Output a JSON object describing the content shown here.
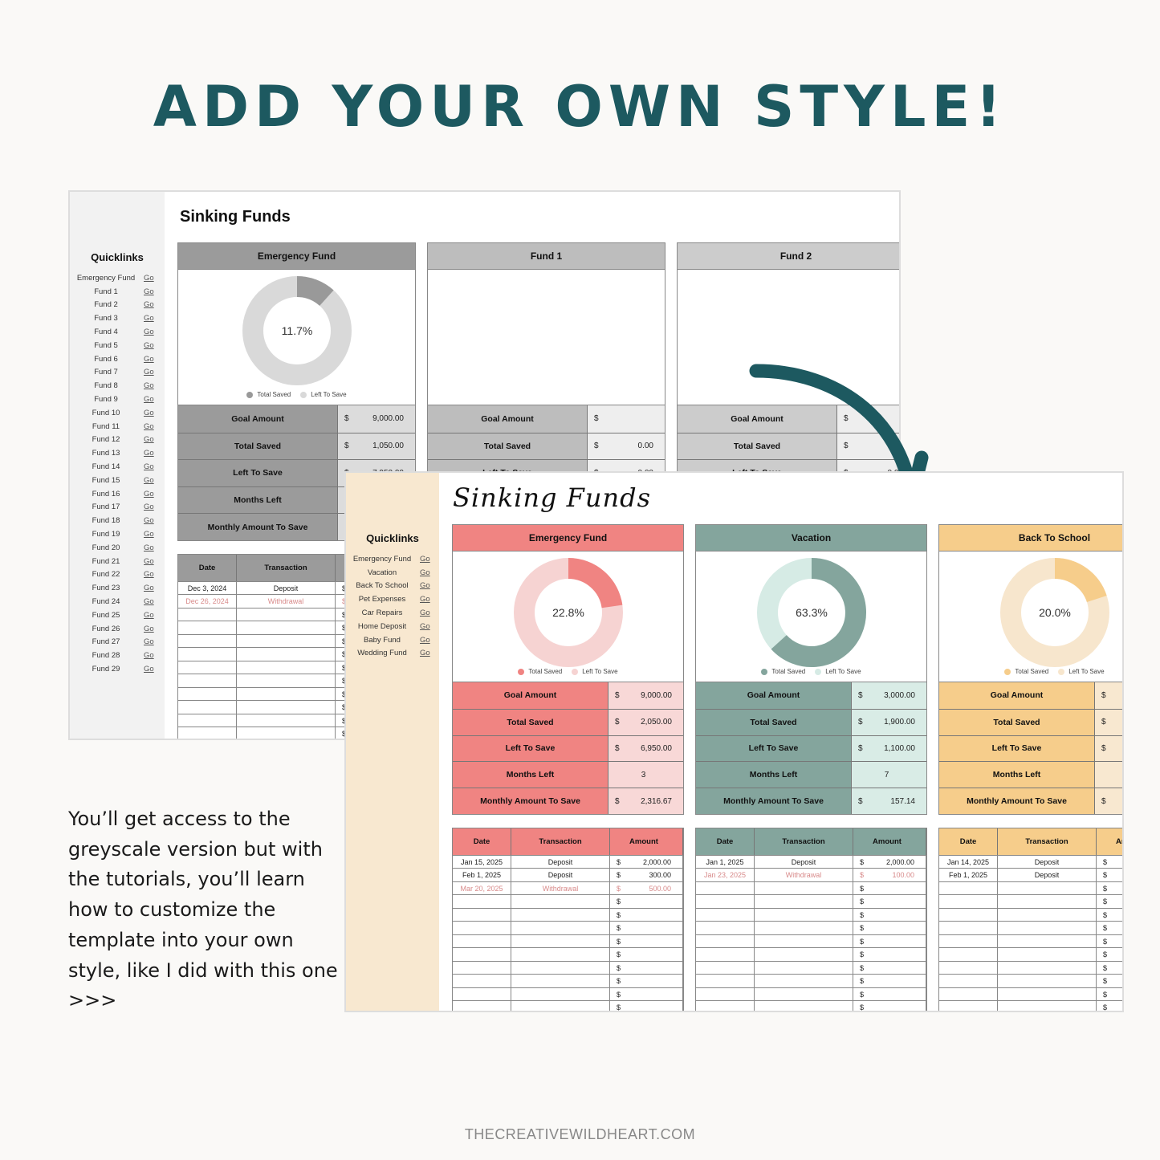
{
  "headline": "ADD YOUR OWN STYLE!",
  "greyscale_sheet": {
    "title": "Sinking Funds",
    "quicklinks_title": "Quicklinks",
    "go_label": "Go",
    "quicklinks": [
      "Emergency Fund",
      "Fund 1",
      "Fund 2",
      "Fund 3",
      "Fund 4",
      "Fund 5",
      "Fund 6",
      "Fund 7",
      "Fund 8",
      "Fund 9",
      "Fund 10",
      "Fund 11",
      "Fund 12",
      "Fund 13",
      "Fund 14",
      "Fund 15",
      "Fund 16",
      "Fund 17",
      "Fund 18",
      "Fund 19",
      "Fund 20",
      "Fund 21",
      "Fund 22",
      "Fund 23",
      "Fund 24",
      "Fund 25",
      "Fund 26",
      "Fund 27",
      "Fund 28",
      "Fund 29"
    ],
    "legend": {
      "saved": "Total Saved",
      "left": "Left To Save"
    },
    "stat_labels": [
      "Goal Amount",
      "Total Saved",
      "Left To Save",
      "Months Left",
      "Monthly Amount To Save"
    ],
    "tx_headers": [
      "Date",
      "Transaction",
      "Amount"
    ],
    "currency": "$",
    "colors": {
      "header": "#9b9b9b",
      "header_light": "#bdbdbd",
      "saved": "#999999",
      "left": "#d9d9d9",
      "val_bg": "#dcdcdc"
    },
    "funds": [
      {
        "name": "Emergency Fund",
        "percent_label": "11.7%",
        "saved_fraction": 0.117,
        "stats": [
          "9,000.00",
          "1,050.00",
          "7,950.00",
          "",
          ""
        ],
        "transactions": [
          {
            "date": "Dec 3, 2024",
            "type": "Deposit",
            "amount": "",
            "withdrawal": false
          },
          {
            "date": "Dec 26, 2024",
            "type": "Withdrawal",
            "amount": "",
            "withdrawal": true
          }
        ]
      },
      {
        "name": "Fund 1",
        "stats": [
          "",
          "0.00",
          "0.00",
          "",
          ""
        ]
      },
      {
        "name": "Fund 2",
        "stats": [
          "",
          "",
          "0.00",
          "",
          ""
        ]
      }
    ]
  },
  "color_sheet": {
    "title": "Sinking Funds",
    "quicklinks_title": "Quicklinks",
    "go_label": "Go",
    "quicklinks": [
      "Emergency Fund",
      "Vacation",
      "Back To School",
      "Pet Expenses",
      "Car Repairs",
      "Home Deposit",
      "Baby Fund",
      "Wedding Fund"
    ],
    "legend": {
      "saved": "Total Saved",
      "left": "Left To Save"
    },
    "stat_labels": [
      "Goal Amount",
      "Total Saved",
      "Left To Save",
      "Months Left",
      "Monthly Amount To Save"
    ],
    "tx_headers": [
      "Date",
      "Transaction",
      "Amount"
    ],
    "currency": "$",
    "funds": [
      {
        "name": "Emergency Fund",
        "percent_label": "22.8%",
        "saved_fraction": 0.228,
        "colors": {
          "header": "#f08482",
          "saved": "#f08482",
          "left": "#f6d3d2",
          "val_bg": "#f8d8d7"
        },
        "stats": [
          "9,000.00",
          "2,050.00",
          "6,950.00",
          "3",
          "2,316.67"
        ],
        "transactions": [
          {
            "date": "Jan 15, 2025",
            "type": "Deposit",
            "amount": "2,000.00",
            "withdrawal": false
          },
          {
            "date": "Feb 1, 2025",
            "type": "Deposit",
            "amount": "300.00",
            "withdrawal": false
          },
          {
            "date": "Mar 20, 2025",
            "type": "Withdrawal",
            "amount": "500.00",
            "withdrawal": true
          }
        ]
      },
      {
        "name": "Vacation",
        "percent_label": "63.3%",
        "saved_fraction": 0.633,
        "colors": {
          "header": "#84a59d",
          "saved": "#84a59d",
          "left": "#d6ebe5",
          "val_bg": "#d9ece6"
        },
        "stats": [
          "3,000.00",
          "1,900.00",
          "1,100.00",
          "7",
          "157.14"
        ],
        "transactions": [
          {
            "date": "Jan 1, 2025",
            "type": "Deposit",
            "amount": "2,000.00",
            "withdrawal": false
          },
          {
            "date": "Jan 23, 2025",
            "type": "Withdrawal",
            "amount": "100.00",
            "withdrawal": true
          }
        ]
      },
      {
        "name": "Back To School",
        "percent_label": "20.0%",
        "saved_fraction": 0.2,
        "colors": {
          "header": "#f6cd8b",
          "saved": "#f6cd8b",
          "left": "#f7e6cd",
          "val_bg": "#f8e8d0"
        },
        "stats": [
          "",
          "",
          "",
          "",
          ""
        ],
        "transactions": [
          {
            "date": "Jan 14, 2025",
            "type": "Deposit",
            "amount": "",
            "withdrawal": false
          },
          {
            "date": "Feb 1, 2025",
            "type": "Deposit",
            "amount": "",
            "withdrawal": false
          }
        ]
      }
    ]
  },
  "blurb": "You’ll get access to the greyscale version but with the tutorials, you’ll learn how to customize the template into your own style, like I did with this one >>>",
  "footer": "THECREATIVEWILDHEART.COM",
  "accent_color": "#1d5960"
}
